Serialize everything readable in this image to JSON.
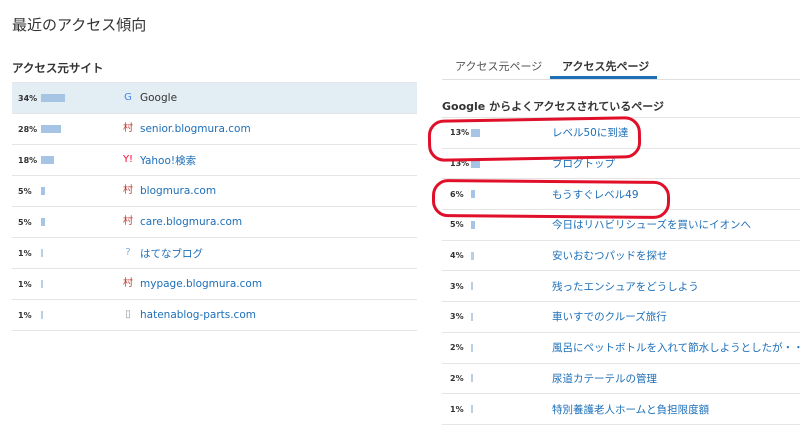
{
  "page_title": "最近のアクセス傾向",
  "left": {
    "heading": "アクセス元サイト",
    "rows": [
      {
        "pct": "34%",
        "value": 34,
        "name": "Google",
        "icon": "google-icon",
        "icon_char": "G",
        "icon_color": "#4285f4"
      },
      {
        "pct": "28%",
        "value": 28,
        "name": "senior.blogmura.com",
        "icon": "blogmura-icon",
        "icon_char": "村",
        "icon_color": "#c0392b"
      },
      {
        "pct": "18%",
        "value": 18,
        "name": "Yahoo!検索",
        "icon": "yahoo-icon",
        "icon_char": "Y!",
        "icon_color": "#ff0033"
      },
      {
        "pct": "5%",
        "value": 5,
        "name": "blogmura.com",
        "icon": "blogmura-icon",
        "icon_char": "村",
        "icon_color": "#c0392b"
      },
      {
        "pct": "5%",
        "value": 5,
        "name": "care.blogmura.com",
        "icon": "blogmura-icon",
        "icon_char": "村",
        "icon_color": "#c0392b"
      },
      {
        "pct": "1%",
        "value": 1,
        "name": "はてなブログ",
        "icon": "question-icon",
        "icon_char": "?",
        "icon_color": "#7ab0dd"
      },
      {
        "pct": "1%",
        "value": 1,
        "name": "mypage.blogmura.com",
        "icon": "blogmura-icon",
        "icon_char": "村",
        "icon_color": "#c0392b"
      },
      {
        "pct": "1%",
        "value": 1,
        "name": "hatenablog-parts.com",
        "icon": "page-icon",
        "icon_char": "▯",
        "icon_color": "#999999"
      }
    ]
  },
  "right": {
    "tabs": [
      "アクセス元ページ",
      "アクセス先ページ"
    ],
    "active_tab": "アクセス先ページ",
    "heading": "Google からよくアクセスされているページ",
    "rows": [
      {
        "pct": "13%",
        "value": 13,
        "title": "レベル50に到達"
      },
      {
        "pct": "13%",
        "value": 13,
        "title": "ブログトップ"
      },
      {
        "pct": "6%",
        "value": 6,
        "title": "もうすぐレベル49"
      },
      {
        "pct": "5%",
        "value": 5,
        "title": "今日はリハビリシューズを買いにイオンへ"
      },
      {
        "pct": "4%",
        "value": 4,
        "title": "安いおむつパッドを探せ"
      },
      {
        "pct": "3%",
        "value": 3,
        "title": "残ったエンシュアをどうしよう"
      },
      {
        "pct": "3%",
        "value": 3,
        "title": "車いすでのクルーズ旅行"
      },
      {
        "pct": "2%",
        "value": 2,
        "title": "風呂にペットボトルを入れて節水しようとしたが・・"
      },
      {
        "pct": "2%",
        "value": 2,
        "title": "尿道カテーテルの管理"
      },
      {
        "pct": "1%",
        "value": 1,
        "title": "特別養護老人ホームと負担限度額"
      }
    ]
  },
  "colors": {
    "link": "#1d6fb8",
    "bar": "#a6c4e3",
    "highlight": "#e3edf4",
    "annotation": "#e0102a"
  }
}
